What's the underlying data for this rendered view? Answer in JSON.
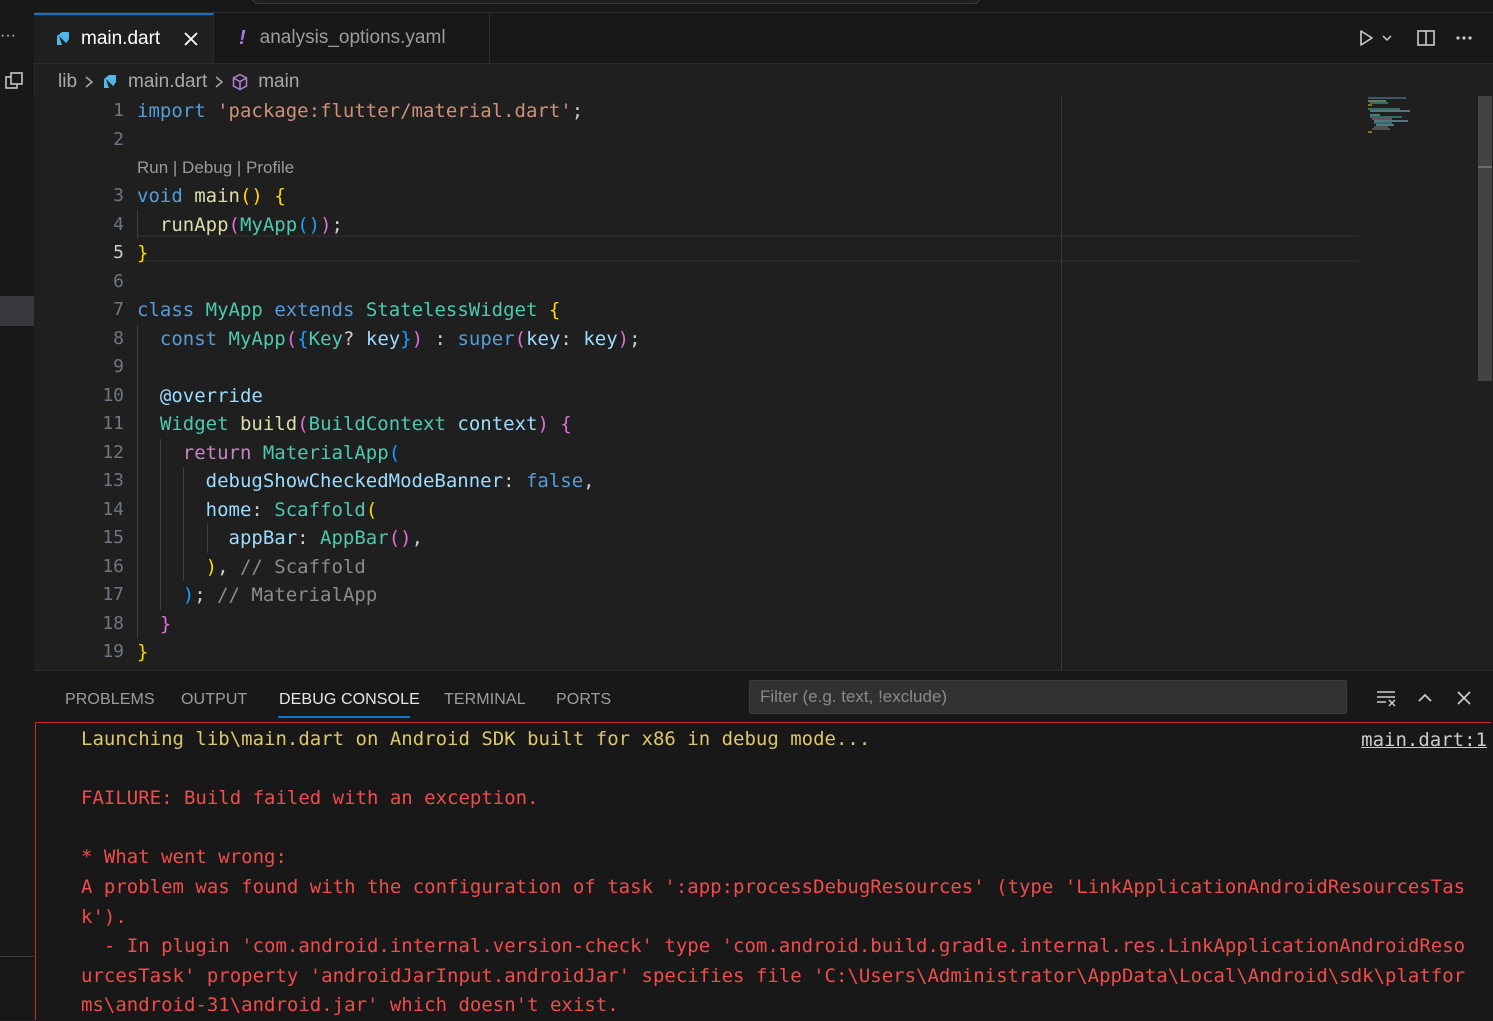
{
  "tabs": [
    {
      "label": "main.dart",
      "active": true
    },
    {
      "label": "analysis_options.yaml",
      "active": false
    }
  ],
  "breadcrumb": [
    "lib",
    "main.dart",
    "main"
  ],
  "codelens": "Run | Debug | Profile",
  "line_numbers": [
    "1",
    "2",
    "3",
    "4",
    "5",
    "6",
    "7",
    "8",
    "9",
    "10",
    "11",
    "12",
    "13",
    "14",
    "15",
    "16",
    "17",
    "18",
    "19"
  ],
  "active_line": 5,
  "code_lines": [
    {
      "ln": 1,
      "tokens": [
        [
          "kw",
          "import"
        ],
        [
          "pn",
          " "
        ],
        [
          "str",
          "'package:flutter/material.dart'"
        ],
        [
          "pn",
          ";"
        ]
      ]
    },
    {
      "ln": 2,
      "tokens": []
    },
    {
      "ln": 3,
      "tokens": [
        [
          "kw",
          "void"
        ],
        [
          "pn",
          " "
        ],
        [
          "fn",
          "main"
        ],
        [
          "b1",
          "()"
        ],
        [
          "pn",
          " "
        ],
        [
          "b1",
          "{"
        ]
      ]
    },
    {
      "ln": 4,
      "tokens": [
        [
          "pn",
          "  "
        ],
        [
          "fn",
          "runApp"
        ],
        [
          "b2",
          "("
        ],
        [
          "ty",
          "MyApp"
        ],
        [
          "b3",
          "()"
        ],
        [
          "b2",
          ")"
        ],
        [
          "pn",
          ";"
        ]
      ]
    },
    {
      "ln": 5,
      "tokens": [
        [
          "b1",
          "}"
        ]
      ]
    },
    {
      "ln": 6,
      "tokens": []
    },
    {
      "ln": 7,
      "tokens": [
        [
          "kw",
          "class"
        ],
        [
          "pn",
          " "
        ],
        [
          "ty",
          "MyApp"
        ],
        [
          "pn",
          " "
        ],
        [
          "kw",
          "extends"
        ],
        [
          "pn",
          " "
        ],
        [
          "ty",
          "StatelessWidget"
        ],
        [
          "pn",
          " "
        ],
        [
          "b1",
          "{"
        ]
      ]
    },
    {
      "ln": 8,
      "tokens": [
        [
          "pn",
          "  "
        ],
        [
          "kw",
          "const"
        ],
        [
          "pn",
          " "
        ],
        [
          "ty",
          "MyApp"
        ],
        [
          "b2",
          "("
        ],
        [
          "b3",
          "{"
        ],
        [
          "ty",
          "Key"
        ],
        [
          "pn",
          "? "
        ],
        [
          "vr",
          "key"
        ],
        [
          "b3",
          "}"
        ],
        [
          "b2",
          ")"
        ],
        [
          "pn",
          " : "
        ],
        [
          "kw",
          "super"
        ],
        [
          "b2",
          "("
        ],
        [
          "vr",
          "key"
        ],
        [
          "pn",
          ": "
        ],
        [
          "vr",
          "key"
        ],
        [
          "b2",
          ")"
        ],
        [
          "pn",
          ";"
        ]
      ]
    },
    {
      "ln": 9,
      "tokens": []
    },
    {
      "ln": 10,
      "tokens": [
        [
          "pn",
          "  "
        ],
        [
          "vr",
          "@override"
        ]
      ]
    },
    {
      "ln": 11,
      "tokens": [
        [
          "pn",
          "  "
        ],
        [
          "ty",
          "Widget"
        ],
        [
          "pn",
          " "
        ],
        [
          "fn",
          "build"
        ],
        [
          "b2",
          "("
        ],
        [
          "ty",
          "BuildContext"
        ],
        [
          "pn",
          " "
        ],
        [
          "vr",
          "context"
        ],
        [
          "b2",
          ")"
        ],
        [
          "pn",
          " "
        ],
        [
          "b2",
          "{"
        ]
      ]
    },
    {
      "ln": 12,
      "tokens": [
        [
          "pn",
          "    "
        ],
        [
          "kp",
          "return"
        ],
        [
          "pn",
          " "
        ],
        [
          "ty",
          "MaterialApp"
        ],
        [
          "b3",
          "("
        ]
      ]
    },
    {
      "ln": 13,
      "tokens": [
        [
          "pn",
          "      "
        ],
        [
          "vr",
          "debugShowCheckedModeBanner"
        ],
        [
          "pn",
          ": "
        ],
        [
          "kw",
          "false"
        ],
        [
          "pn",
          ","
        ]
      ]
    },
    {
      "ln": 14,
      "tokens": [
        [
          "pn",
          "      "
        ],
        [
          "vr",
          "home"
        ],
        [
          "pn",
          ": "
        ],
        [
          "ty",
          "Scaffold"
        ],
        [
          "b1",
          "("
        ]
      ]
    },
    {
      "ln": 15,
      "tokens": [
        [
          "pn",
          "        "
        ],
        [
          "vr",
          "appBar"
        ],
        [
          "pn",
          ": "
        ],
        [
          "ty",
          "AppBar"
        ],
        [
          "b2",
          "()"
        ],
        [
          "pn",
          ","
        ]
      ]
    },
    {
      "ln": 16,
      "tokens": [
        [
          "pn",
          "      "
        ],
        [
          "b1",
          ")"
        ],
        [
          "pn",
          ", "
        ],
        [
          "cm",
          "// Scaffold"
        ]
      ]
    },
    {
      "ln": 17,
      "tokens": [
        [
          "pn",
          "    "
        ],
        [
          "b3",
          ")"
        ],
        [
          "pn",
          "; "
        ],
        [
          "cm",
          "// MaterialApp"
        ]
      ]
    },
    {
      "ln": 18,
      "tokens": [
        [
          "pn",
          "  "
        ],
        [
          "b2",
          "}"
        ]
      ]
    },
    {
      "ln": 19,
      "tokens": [
        [
          "b1",
          "}"
        ]
      ]
    }
  ],
  "panel": {
    "tabs": [
      "PROBLEMS",
      "OUTPUT",
      "DEBUG CONSOLE",
      "TERMINAL",
      "PORTS"
    ],
    "active_tab": "DEBUG CONSOLE",
    "filter_placeholder": "Filter (e.g. text, !exclude)"
  },
  "console": {
    "source_link": "main.dart:1",
    "lines": [
      {
        "text": "Launching lib\\main.dart on Android SDK built for x86 in debug mode...",
        "kind": "info"
      },
      {
        "text": "",
        "kind": "blank"
      },
      {
        "text": "FAILURE: Build failed with an exception.",
        "kind": "error"
      },
      {
        "text": "",
        "kind": "blank"
      },
      {
        "text": "* What went wrong:",
        "kind": "error"
      },
      {
        "text": "A problem was found with the configuration of task ':app:processDebugResources' (type 'LinkApplicationAndroidResourcesTas",
        "kind": "error"
      },
      {
        "text": "k').",
        "kind": "error"
      },
      {
        "text": "  - In plugin 'com.android.internal.version-check' type 'com.android.build.gradle.internal.res.LinkApplicationAndroidReso",
        "kind": "error"
      },
      {
        "text": "urcesTask' property 'androidJarInput.androidJar' specifies file 'C:\\Users\\Administrator\\AppData\\Local\\Android\\sdk\\platfor",
        "kind": "error"
      },
      {
        "text": "ms\\android-31\\android.jar' which doesn't exist.",
        "kind": "error"
      }
    ]
  },
  "colors": {
    "accent": "#0078d4",
    "error": "#f14c4c",
    "info": "#dcc76b",
    "editor_bg": "#1f1f1f"
  }
}
